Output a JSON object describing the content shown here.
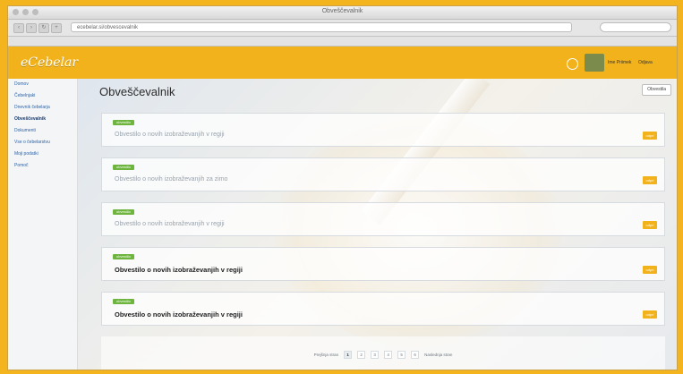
{
  "browser": {
    "window_title": "Obveščevalnik",
    "url": "ecebelar.si/obvescevalnik",
    "search_placeholder": ""
  },
  "header": {
    "logo": "eCebelar",
    "user_name": "Ime Priimek",
    "logout": "Odjava"
  },
  "sidebar": {
    "items": [
      {
        "label": "Domov",
        "active": false
      },
      {
        "label": "Čebelnjaki",
        "active": false
      },
      {
        "label": "Dnevnik čebelarja",
        "active": false
      },
      {
        "label": "Obveščevalnik",
        "active": true
      },
      {
        "label": "Dokumenti",
        "active": false
      },
      {
        "label": "Vse o čebelarstvu",
        "active": false
      },
      {
        "label": "Moji podatki",
        "active": false
      },
      {
        "label": "Pomoč",
        "active": false
      }
    ]
  },
  "main": {
    "page_title": "Obveščevalnik",
    "notify_button": "Obvestila",
    "notifications": [
      {
        "badge": "obvestilo",
        "meta": "",
        "title": "Obvestilo o novih izobraževanjih v regiji",
        "read": true
      },
      {
        "badge": "obvestilo",
        "meta": "",
        "title": "Obvestilo o novih izobraževanjih za zimo",
        "read": true
      },
      {
        "badge": "obvestilo",
        "meta": "",
        "title": "Obvestilo o novih izobraževanjih v regiji",
        "read": true
      },
      {
        "badge": "obvestilo",
        "meta": "",
        "title": "Obvestilo o novih izobraževanjih v regiji",
        "read": false
      },
      {
        "badge": "obvestilo",
        "meta": "",
        "title": "Obvestilo o novih izobraževanjih v regiji",
        "read": false
      }
    ],
    "open_label": "odpri",
    "pagination": {
      "prev": "Prejšnja stran",
      "pages": [
        "1",
        "2",
        "3",
        "4",
        "5",
        "6"
      ],
      "current": "1",
      "next": "Naslednja stran"
    }
  },
  "colors": {
    "brand": "#f2b21b",
    "badge": "#6eb53f"
  }
}
